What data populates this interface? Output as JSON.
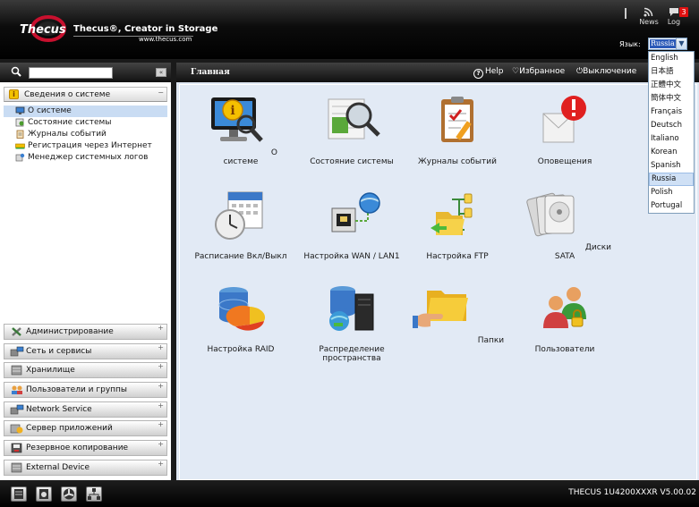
{
  "header": {
    "brand": "Thecus",
    "tagline": "Thecus®, Creator in Storage",
    "website": "www.thecus.com",
    "news_label": "News",
    "log_label": "Log",
    "log_count": "3",
    "language_label": "Язык:",
    "language_selected": "Russia"
  },
  "language_options": [
    "English",
    "日本語",
    "正體中文",
    "簡体中文",
    "Français",
    "Deutsch",
    "Italiano",
    "Korean",
    "Spanish",
    "Russia",
    "Polish",
    "Portugal"
  ],
  "sidebar": {
    "search_placeholder": "",
    "collapse_glyph": "«",
    "open_section": "Сведения о системе",
    "tree_items": [
      "О системе",
      "Состояние системы",
      "Журналы событий",
      "Регистрация через Интернет",
      "Менеджер системных логов"
    ],
    "sections": [
      "Администрирование",
      "Сеть и сервисы",
      "Хранилище",
      "Пользователи и группы",
      "Network Service",
      "Сервер приложений",
      "Резервное копирование",
      "External Device"
    ]
  },
  "main": {
    "title": "Главная",
    "help_label": "Help",
    "favorites_label": "Избранное",
    "logout_label": "Выключение",
    "tiles": [
      "О системе",
      "Состояние системы",
      "Журналы событий",
      "Оповещения",
      "Расписание Вкл/Выкл",
      "Настройка WAN / LAN1",
      "Настройка FTP",
      "Диски SATA",
      "Настройка RAID",
      "Распределение пространства",
      "Папки",
      "Пользователи"
    ]
  },
  "footer": {
    "version": "THECUS 1U4200XXXR V5.00.02"
  }
}
